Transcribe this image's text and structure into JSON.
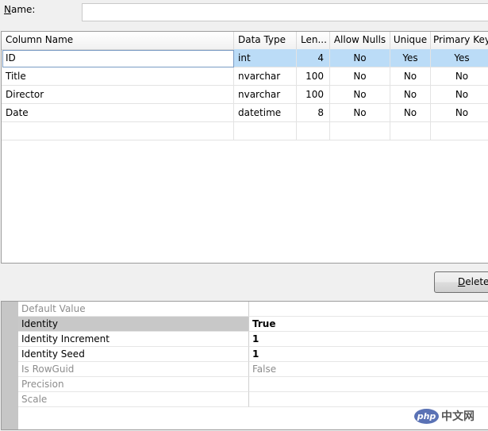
{
  "name_field": {
    "label_mnemonic": "N",
    "label_rest": "ame:",
    "value": ""
  },
  "columns_grid": {
    "headers": [
      "Column Name",
      "Data Type",
      "Len...",
      "Allow Nulls",
      "Unique",
      "Primary Key"
    ],
    "rows": [
      {
        "name": "ID",
        "type": "int",
        "length": "4",
        "allow_nulls": "No",
        "unique": "Yes",
        "primary_key": "Yes"
      },
      {
        "name": "Title",
        "type": "nvarchar",
        "length": "100",
        "allow_nulls": "No",
        "unique": "No",
        "primary_key": "No"
      },
      {
        "name": "Director",
        "type": "nvarchar",
        "length": "100",
        "allow_nulls": "No",
        "unique": "No",
        "primary_key": "No"
      },
      {
        "name": "Date",
        "type": "datetime",
        "length": "8",
        "allow_nulls": "No",
        "unique": "No",
        "primary_key": "No"
      }
    ],
    "selected_row_color": "#bbdcf7"
  },
  "toolbar": {
    "delete_mnemonic": "D",
    "delete_rest": "elete"
  },
  "properties": [
    {
      "name": "Default Value",
      "value": "",
      "state": "disabled"
    },
    {
      "name": "Identity",
      "value": "True",
      "state": "active"
    },
    {
      "name": "Identity Increment",
      "value": "1",
      "state": "active"
    },
    {
      "name": "Identity Seed",
      "value": "1",
      "state": "active"
    },
    {
      "name": "Is RowGuid",
      "value": "False",
      "state": "disabled"
    },
    {
      "name": "Precision",
      "value": "",
      "state": "disabled"
    },
    {
      "name": "Scale",
      "value": "",
      "state": "disabled"
    }
  ],
  "watermark": {
    "logo_text": "php",
    "site_text": "中文网"
  }
}
